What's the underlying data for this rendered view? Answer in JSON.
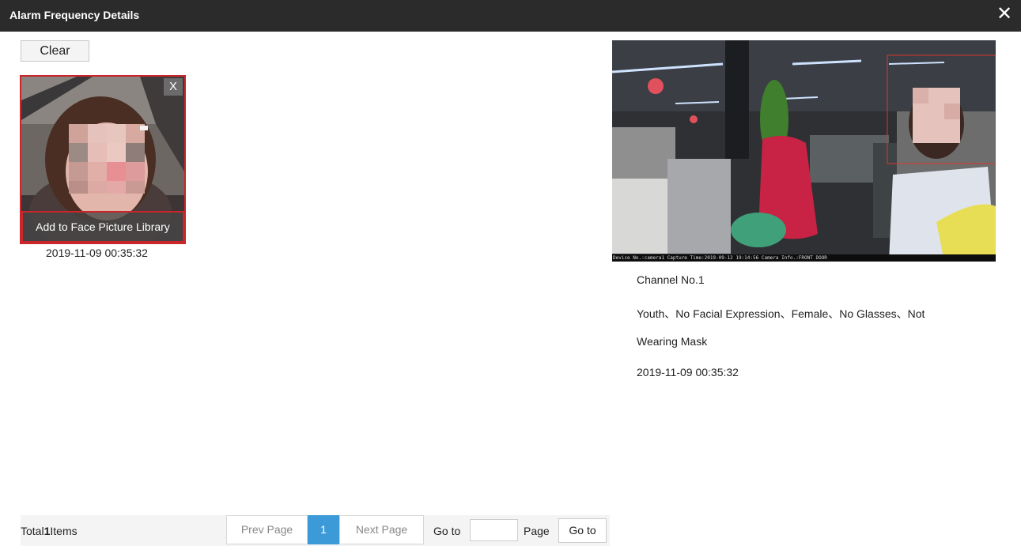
{
  "dialog": {
    "title": "Alarm Frequency Details",
    "close_icon": "close-icon"
  },
  "toolbar": {
    "clear_label": "Clear"
  },
  "results": [
    {
      "remove_label": "X",
      "add_library_label": "Add to Face Picture Library",
      "time": "2019-11-09 00:35:32"
    }
  ],
  "detail": {
    "osd_text": "Device No.:camera1  Capture Time:2019-09-12 19:14:56   Camera Info.:FRONT DOOR",
    "channel": "Channel No.1",
    "attributes_line1": "Youth、No Facial Expression、Female、No Glasses、Not",
    "attributes_line2": "Wearing Mask",
    "time": "2019-11-09 00:35:32"
  },
  "pagination": {
    "total_prefix": "Total",
    "total_count": "1",
    "total_suffix": "Items",
    "prev_label": "Prev Page",
    "current_page": "1",
    "next_label": "Next Page",
    "goto_label": "Go to",
    "goto_value": "",
    "page_label": "Page",
    "goto_button_label": "Go to"
  },
  "colors": {
    "titlebar": "#2b2b2b",
    "highlight_border": "#c8262b",
    "current_page": "#3d9ad8"
  }
}
